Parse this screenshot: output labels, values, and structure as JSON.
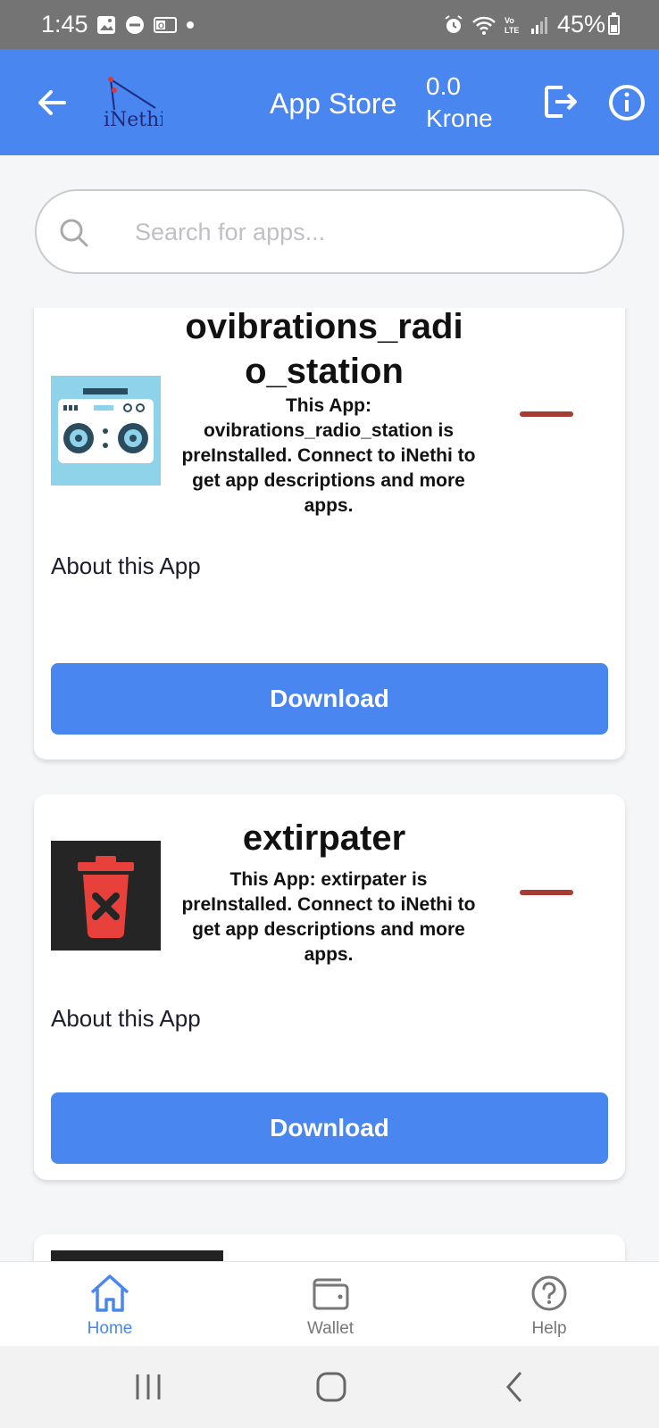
{
  "status_bar": {
    "time": "1:45",
    "battery": "45%",
    "battery_level": 0.45,
    "icons": [
      "gallery-icon",
      "dnd-icon",
      "outlook-icon",
      "dot-icon",
      "alarm-icon",
      "wifi-icon",
      "volte-icon",
      "signal-icon",
      "battery-icon"
    ]
  },
  "app_bar": {
    "logo_text": "iNethi",
    "title": "App Store",
    "balance_amount": "0.0",
    "balance_currency": "Krone",
    "back_icon": "arrow-left-icon",
    "logout_icon": "logout-icon",
    "info_icon": "info-icon"
  },
  "search": {
    "placeholder": "Search for apps...",
    "value": ""
  },
  "apps": [
    {
      "name": "ovibrations_radio_station",
      "description": "This App: ovibrations_radio_station is preInstalled. Connect to iNethi to get app descriptions and more apps.",
      "about_label": "About this App",
      "download_label": "Download",
      "icon": "radio-icon"
    },
    {
      "name": "extirpater",
      "description": "This App: extirpater is preInstalled. Connect to iNethi to get app descriptions and more apps.",
      "about_label": "About this App",
      "download_label": "Download",
      "icon": "trash-icon"
    }
  ],
  "bottom_nav": {
    "items": [
      {
        "label": "Home",
        "icon": "home-icon",
        "active": true
      },
      {
        "label": "Wallet",
        "icon": "wallet-icon",
        "active": false
      },
      {
        "label": "Help",
        "icon": "help-icon",
        "active": false
      }
    ]
  },
  "colors": {
    "primary": "#4a86ef",
    "remove": "#a83a34",
    "status_bar": "#747474"
  }
}
